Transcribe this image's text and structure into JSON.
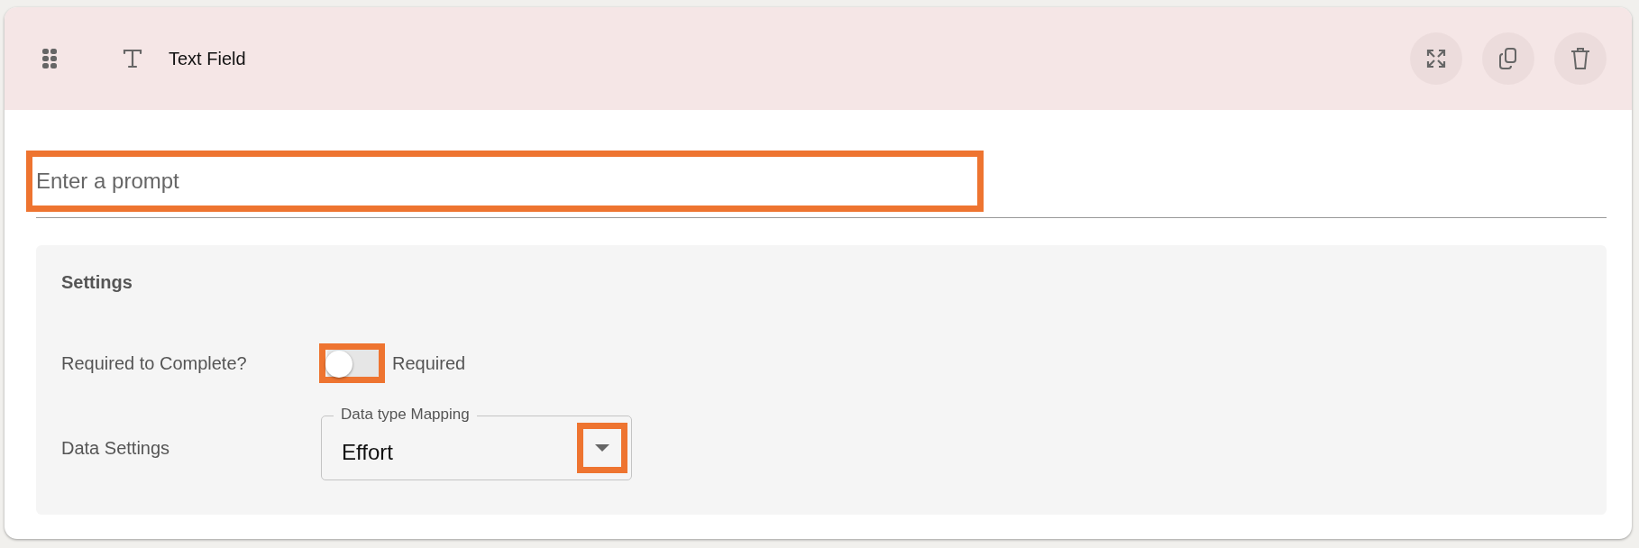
{
  "header": {
    "title": "Text Field"
  },
  "prompt": {
    "placeholder": "Enter a prompt",
    "highlighted": true
  },
  "settings": {
    "title": "Settings",
    "required": {
      "label": "Required to Complete?",
      "on": false,
      "text": "Required",
      "highlighted": true
    },
    "data": {
      "label": "Data Settings",
      "field_label": "Data type Mapping",
      "value": "Effort",
      "caret_highlighted": true
    }
  }
}
